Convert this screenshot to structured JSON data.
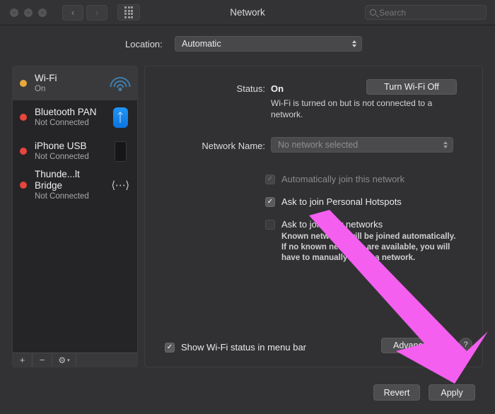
{
  "window": {
    "title": "Network",
    "traffic_lights": [
      "close",
      "minimize",
      "zoom"
    ],
    "nav_back": "‹",
    "nav_forward": "›",
    "show_all_icon": "grid-icon"
  },
  "search": {
    "placeholder": "Search",
    "value": "",
    "icon": "search-icon"
  },
  "location": {
    "label": "Location:",
    "value": "Automatic"
  },
  "sidebar": {
    "services": [
      {
        "name": "Wi-Fi",
        "status": "On",
        "dot_color": "#e8a93a",
        "icon": "wifi-icon",
        "selected": true
      },
      {
        "name": "Bluetooth PAN",
        "status": "Not Connected",
        "dot_color": "#e8453c",
        "icon": "bluetooth-icon",
        "selected": false
      },
      {
        "name": "iPhone USB",
        "status": "Not Connected",
        "dot_color": "#e8453c",
        "icon": "iphone-icon",
        "selected": false
      },
      {
        "name": "Thunde...lt Bridge",
        "status": "Not Connected",
        "dot_color": "#e8453c",
        "icon": "thunderbolt-icon",
        "selected": false
      }
    ],
    "toolbar": {
      "add": "+",
      "remove": "−",
      "gear": "⚙",
      "gear_chevron": "▾"
    }
  },
  "main": {
    "status_label": "Status:",
    "status_value": "On",
    "turn_wifi_button": "Turn Wi-Fi Off",
    "status_description": "Wi-Fi is turned on but is not connected to a network.",
    "network_name_label": "Network Name:",
    "network_name_value": "No network selected",
    "checkboxes": [
      {
        "label": "Automatically join this network",
        "state": "disabled",
        "mark": "✓"
      },
      {
        "label": "Ask to join Personal Hotspots",
        "state": "on",
        "mark": "✓"
      },
      {
        "label": "Ask to join new networks",
        "state": "off",
        "mark": ""
      }
    ],
    "hint_text": "Known networks will be joined automatically. If no known networks are available, you will have to manually select a network.",
    "menu_bar_checkbox": {
      "label": "Show Wi-Fi status in menu bar",
      "state": "on",
      "mark": "✓"
    },
    "advanced_button": "Advanced...",
    "help_button": "?"
  },
  "footer": {
    "revert_button": "Revert",
    "apply_button": "Apply"
  },
  "annotation": {
    "arrow_color": "#f45ff0",
    "points_to": "Apply"
  }
}
